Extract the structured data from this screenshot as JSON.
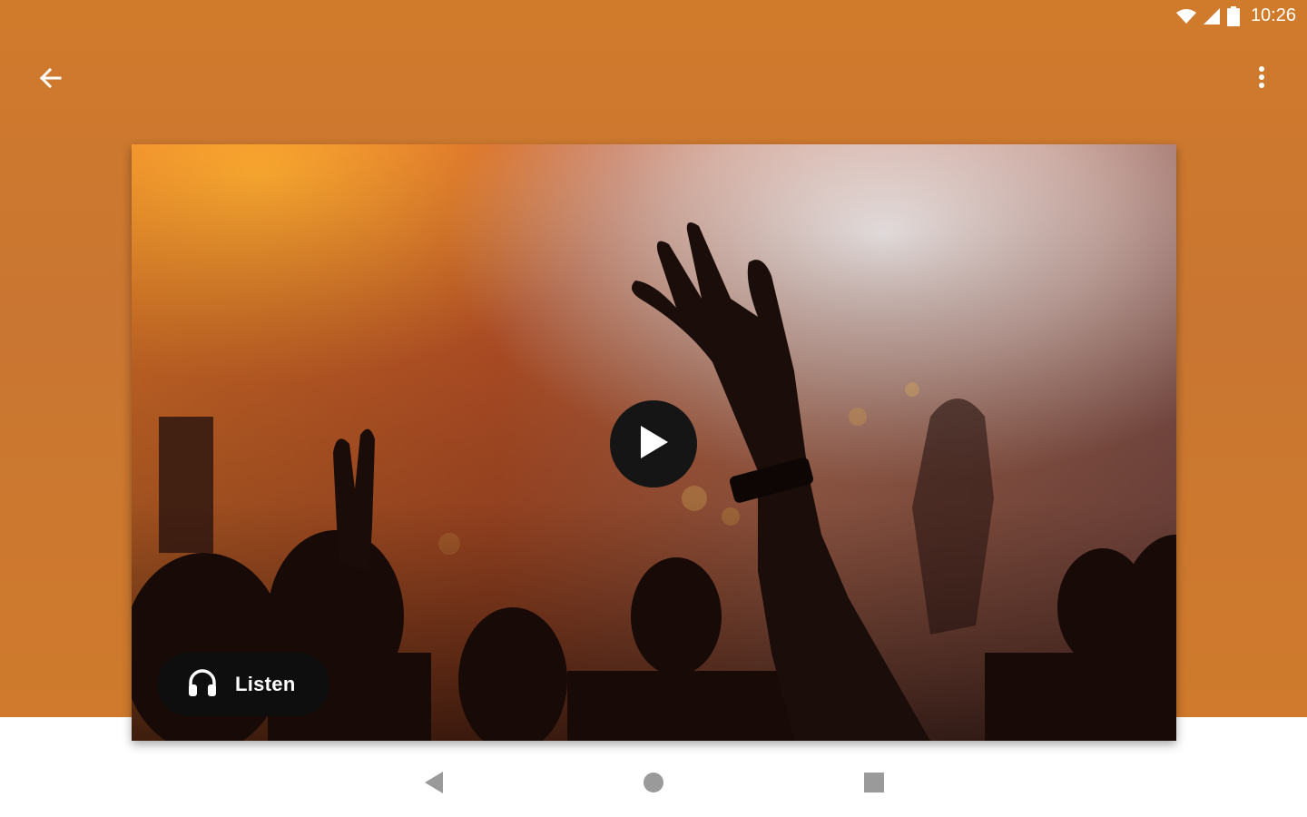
{
  "status_bar": {
    "time": "10:26",
    "icons": [
      "wifi-icon",
      "signal-icon",
      "battery-icon"
    ]
  },
  "toolbar": {
    "back_icon": "arrow-back-icon",
    "more_icon": "more-vertical-icon"
  },
  "media": {
    "play_icon": "play-icon",
    "listen_label": "Listen",
    "listen_icon": "headphones-icon"
  },
  "navigation": {
    "items": [
      "back-triangle-icon",
      "home-circle-icon",
      "recents-square-icon"
    ]
  },
  "colors": {
    "accent": "#cd7a2e",
    "button_dark": "#111111"
  }
}
